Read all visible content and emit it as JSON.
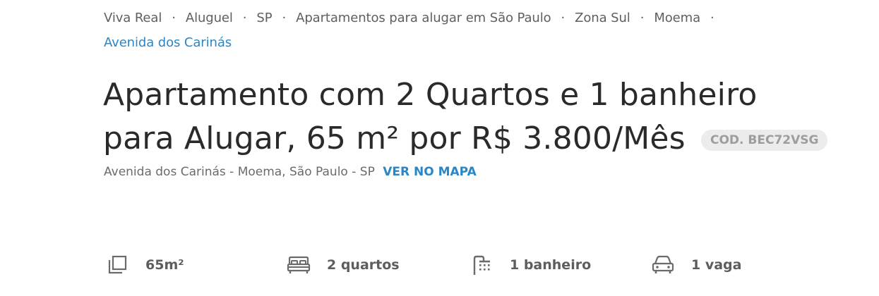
{
  "breadcrumb": {
    "items": [
      "Viva Real",
      "Aluguel",
      "SP",
      "Apartamentos para alugar em São Paulo",
      "Zona Sul",
      "Moema"
    ],
    "current": "Avenida dos Carinás",
    "separator": "·"
  },
  "listing": {
    "title_line1": "Apartamento com 2 Quartos e 1 banheiro",
    "title_line2": "para Alugar, 65 m² por R$ 3.800/Mês",
    "code": "COD. BEC72VSG",
    "address": "Avenida dos Carinás - Moema, São Paulo - SP",
    "map_link": "VER NO MAPA"
  },
  "features": [
    {
      "icon": "area-icon",
      "label": "65m²"
    },
    {
      "icon": "bed-icon",
      "label": "2 quartos"
    },
    {
      "icon": "shower-icon",
      "label": "1 banheiro"
    },
    {
      "icon": "car-icon",
      "label": "1 vaga"
    }
  ],
  "colors": {
    "link": "#2b86c6",
    "text": "#2a2a2a",
    "muted": "#5f5f5f",
    "badge_bg": "#ececec",
    "badge_text": "#9d9d9d"
  }
}
